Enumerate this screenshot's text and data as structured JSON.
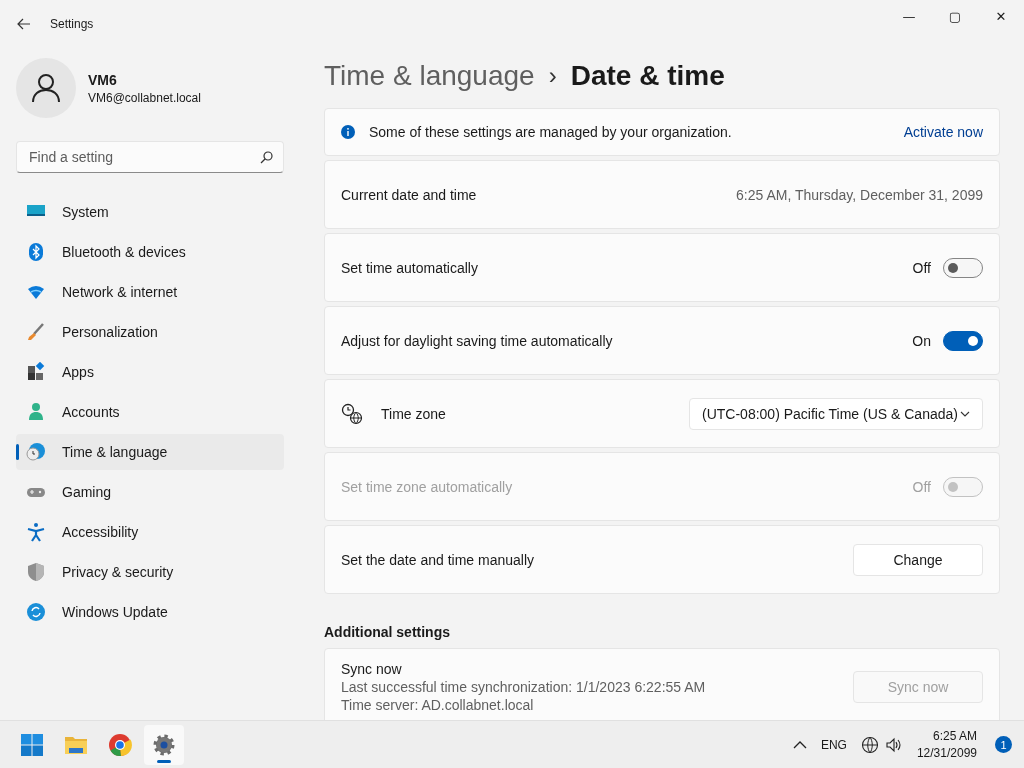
{
  "window": {
    "title": "Settings",
    "controls": [
      "—",
      "▢",
      "✕"
    ]
  },
  "profile": {
    "name": "VM6",
    "email": "VM6@collabnet.local"
  },
  "search": {
    "placeholder": "Find a setting"
  },
  "sidebar": {
    "items": [
      {
        "label": "System",
        "selected": false
      },
      {
        "label": "Bluetooth & devices",
        "selected": false
      },
      {
        "label": "Network & internet",
        "selected": false
      },
      {
        "label": "Personalization",
        "selected": false
      },
      {
        "label": "Apps",
        "selected": false
      },
      {
        "label": "Accounts",
        "selected": false
      },
      {
        "label": "Time & language",
        "selected": true
      },
      {
        "label": "Gaming",
        "selected": false
      },
      {
        "label": "Accessibility",
        "selected": false
      },
      {
        "label": "Privacy & security",
        "selected": false
      },
      {
        "label": "Windows Update",
        "selected": false
      }
    ]
  },
  "breadcrumb": {
    "parent": "Time & language",
    "separator": "›",
    "current": "Date & time"
  },
  "settings": [
    {
      "kind": "info",
      "label": "Some of these settings are managed by your organization.",
      "action": "Activate now"
    },
    {
      "kind": "value",
      "label": "Current date and time",
      "value": "6:25 AM, Thursday, December 31, 2099"
    },
    {
      "kind": "toggle",
      "label": "Set time automatically",
      "state_text": "Off",
      "on": false,
      "disabled": false
    },
    {
      "kind": "toggle",
      "label": "Adjust for daylight saving time automatically",
      "state_text": "On",
      "on": true,
      "disabled": false
    },
    {
      "kind": "select",
      "label": "Time zone",
      "value": "(UTC-08:00) Pacific Time (US & Canada)"
    },
    {
      "kind": "toggle",
      "label": "Set time zone automatically",
      "state_text": "Off",
      "on": false,
      "disabled": true
    },
    {
      "kind": "button",
      "label": "Set the date and time manually",
      "button": "Change"
    }
  ],
  "additional": {
    "heading": "Additional settings",
    "sync": {
      "title": "Sync now",
      "lines": [
        "Last successful time synchronization: 1/1/2023 6:22:55 AM",
        "Time server: AD.collabnet.local"
      ],
      "button": "Sync now",
      "disabled": true
    }
  },
  "taskbar": {
    "apps": [
      {
        "selected": false
      },
      {
        "selected": false
      },
      {
        "selected": false
      },
      {
        "selected": true
      }
    ],
    "language": "ENG",
    "time": "6:25 AM",
    "date": "12/31/2099",
    "notifications": "1"
  }
}
